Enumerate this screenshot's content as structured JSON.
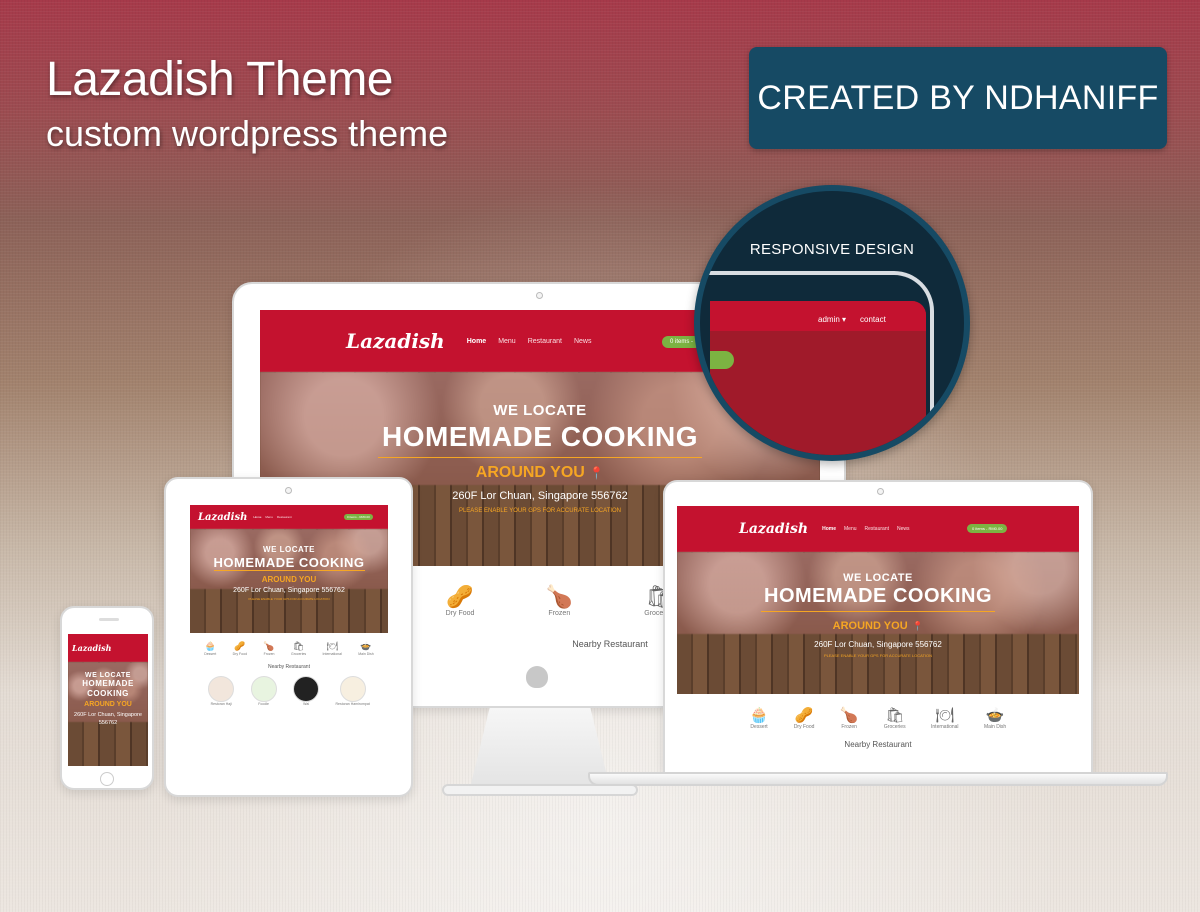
{
  "headline": {
    "title": "Lazadish Theme",
    "subtitle": "custom wordpress theme"
  },
  "credit": "CREATED BY NDHANIFF",
  "magnifier": {
    "label": "RESPONSIVE DESIGN",
    "admin": "admin ▾",
    "contact": "contact"
  },
  "site": {
    "logo": "Lazadish",
    "nav": [
      "Home",
      "Menu",
      "Restaurant",
      "News"
    ],
    "cart_short": "0 items -",
    "cart_full": "0 items - RM0.00",
    "hero_small": "WE LOCATE",
    "hero_big": "HOMEMADE COOKING",
    "hero_orange": "AROUND YOU",
    "address": "260F Lor Chuan, Singapore 556762",
    "gps_notice": "PLEASE ENABLE YOUR GPS FOR ACCURATE LOCATION",
    "categories": [
      "Dessert",
      "Dry Food",
      "Frozen",
      "Groceries",
      "International",
      "Main Dish"
    ],
    "section_title": "Nearby Restaurant",
    "restaurants": [
      "Restoran Haji",
      "Foodie",
      "Wai",
      "Restoran Hamirompat"
    ]
  },
  "icons": {
    "pin": "📍",
    "dessert": "🧁",
    "dry_food": "🥜",
    "frozen": "🍗",
    "groceries": "🛍",
    "international": "🍽",
    "main_dish": "🍲",
    "apple": ""
  },
  "colors": {
    "brand_red": "#c4122f",
    "accent_orange": "#f6a623",
    "cart_green": "#7cb342",
    "credit_bg": "#164a64"
  }
}
